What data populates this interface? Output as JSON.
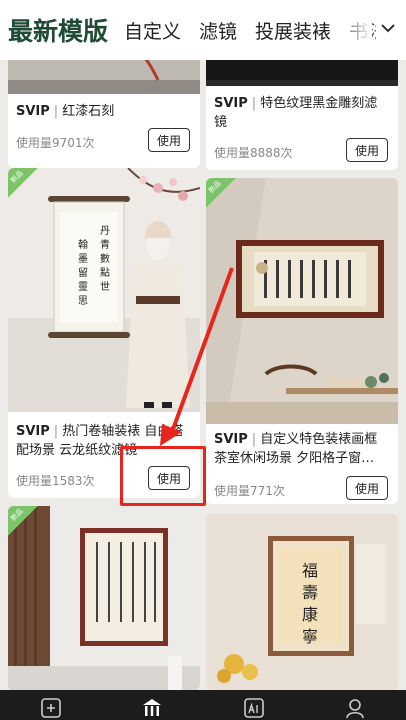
{
  "tabs": {
    "active": "最新模版",
    "items": [
      "自定义",
      "滤镜",
      "投展装裱",
      "书法"
    ]
  },
  "cards": [
    {
      "svip": "SVIP",
      "name": "红漆石刻",
      "usage": "使用量9701次",
      "button": "使用"
    },
    {
      "svip": "SVIP",
      "name": "特色纹理黑金雕刻滤镜",
      "usage": "使用量8888次",
      "button": "使用"
    },
    {
      "svip": "SVIP",
      "name": "热门卷轴装裱 自由搭配场景 云龙纸纹滤镜",
      "usage": "使用量1583次",
      "button": "使用"
    },
    {
      "svip": "SVIP",
      "name": "自定义特色装裱画框 茶室休闲场景 夕阳格子窗…",
      "usage": "使用量771次",
      "button": "使用"
    }
  ],
  "art": {
    "scroll_text": "丹青数点世 翰墨留灵思",
    "right_frame_text": "福 壽 康 寧",
    "left_frame_text": "春城無處不飛花 寒食東風御柳斜 日暮漢宮傳蠟燭 輕煙散入五侯家",
    "badge": "新品"
  },
  "colors": {
    "accent": "#1f4a34",
    "annotation": "#e8241c",
    "nav_bg": "#1c1c1c"
  }
}
